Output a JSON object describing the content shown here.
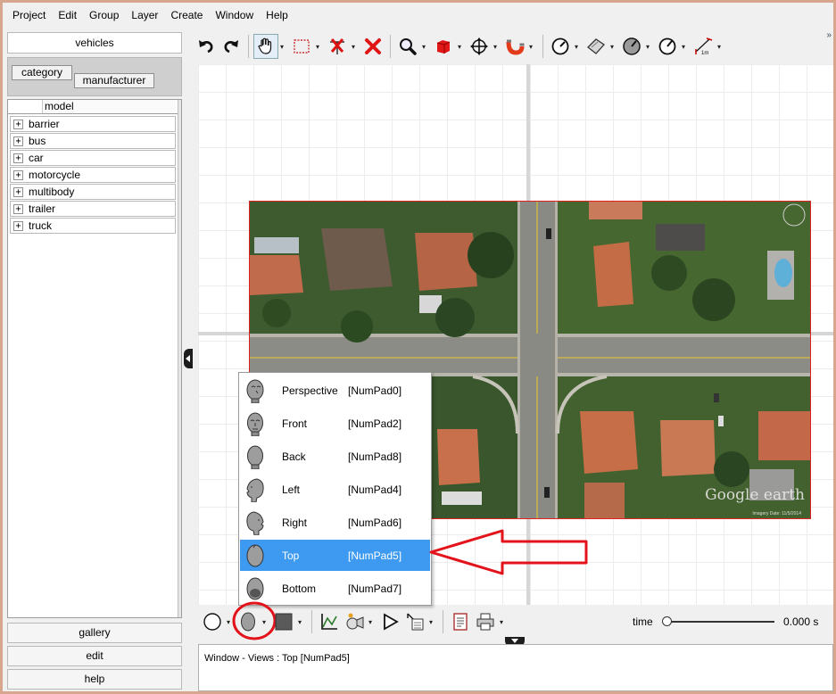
{
  "menubar": {
    "items": [
      {
        "label": "Project"
      },
      {
        "label": "Edit"
      },
      {
        "label": "Group"
      },
      {
        "label": "Layer"
      },
      {
        "label": "Create"
      },
      {
        "label": "Window"
      },
      {
        "label": "Help"
      }
    ]
  },
  "left_panel": {
    "vehicles_label": "vehicles",
    "tabs": {
      "category": "category",
      "manufacturer": "manufacturer"
    },
    "tree_header": "model",
    "tree_items": [
      {
        "label": "barrier"
      },
      {
        "label": "bus"
      },
      {
        "label": "car"
      },
      {
        "label": "motorcycle"
      },
      {
        "label": "multibody"
      },
      {
        "label": "trailer"
      },
      {
        "label": "truck"
      }
    ],
    "expander_glyph": "+",
    "gallery_label": "gallery",
    "edit_label": "edit",
    "help_label": "help"
  },
  "toolbar": {
    "icons": [
      "undo-icon",
      "redo-icon",
      "hand-pan-icon",
      "selection-rectangle-icon",
      "delete-nodes-icon",
      "delete-icon",
      "zoom-icon",
      "cube-icon",
      "move-icon",
      "magnet-icon",
      "measure-angle-icon",
      "paper-plane-icon",
      "gauge-icon",
      "measure-circle-icon",
      "scale-ruler-icon"
    ],
    "scale_label": "1m",
    "overflow_glyph": "»"
  },
  "canvas": {
    "background_color": "#ffffff",
    "image_border_color": "#dd2222",
    "watermark": "Google earth",
    "image_credit": "Imagery Date: 11/5/2014"
  },
  "view_menu": {
    "items": [
      {
        "label": "Perspective",
        "shortcut": "[NumPad0]",
        "icon": "head-perspective-icon"
      },
      {
        "label": "Front",
        "shortcut": "[NumPad2]",
        "icon": "head-front-icon"
      },
      {
        "label": "Back",
        "shortcut": "[NumPad8]",
        "icon": "head-back-icon"
      },
      {
        "label": "Left",
        "shortcut": "[NumPad4]",
        "icon": "head-left-icon"
      },
      {
        "label": "Right",
        "shortcut": "[NumPad6]",
        "icon": "head-right-icon"
      },
      {
        "label": "Top",
        "shortcut": "[NumPad5]",
        "icon": "head-top-icon"
      },
      {
        "label": "Bottom",
        "shortcut": "[NumPad7]",
        "icon": "head-bottom-icon"
      }
    ],
    "selected": "Top",
    "selected_color": "#3d9af0"
  },
  "bottom_toolbar": {
    "icons": [
      "circle-icon",
      "view-head-icon",
      "color-swatch-icon",
      "chart-icon",
      "camera-icon",
      "play-icon",
      "report-icon",
      "document-icon",
      "printer-icon"
    ],
    "time_label": "time",
    "time_value": "0.000 s",
    "time_position": 0
  },
  "status": {
    "text": "Window - Views : Top [NumPad5]"
  },
  "annotation_color": "#e3131b"
}
